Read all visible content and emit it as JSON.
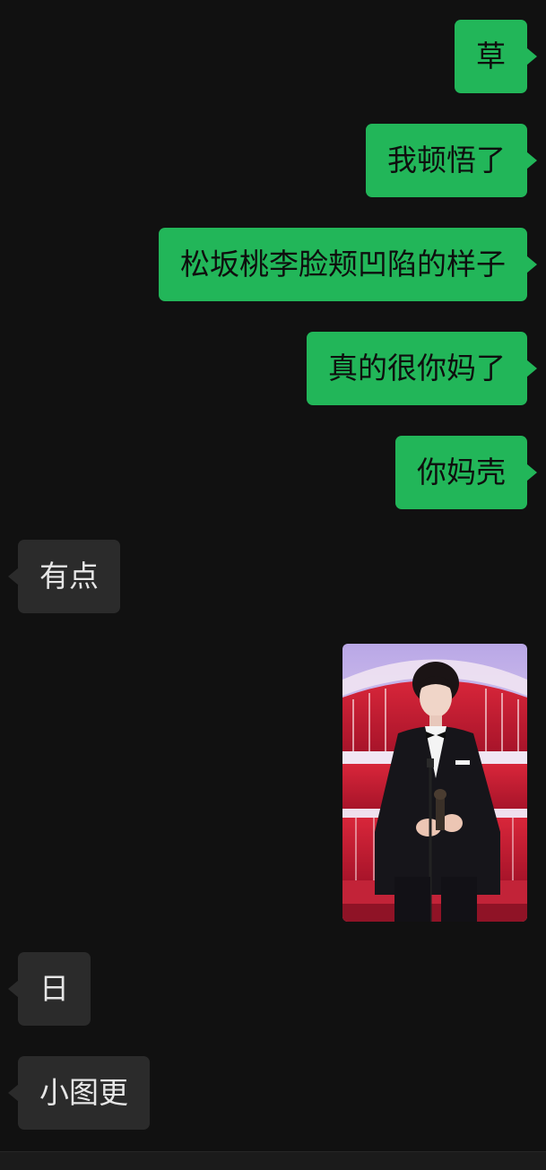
{
  "messages": [
    {
      "text": "草"
    },
    {
      "text": "我顿悟了"
    },
    {
      "text": "松坂桃李脸颊凹陷的样子"
    },
    {
      "text": "真的很你妈了"
    },
    {
      "text": "你妈壳"
    },
    {
      "text": "有点"
    },
    {
      "image": "photo-man-in-tuxedo-holding-award"
    },
    {
      "text": "日"
    },
    {
      "text": "小图更"
    }
  ],
  "colors": {
    "background": "#111111",
    "outgoing_bubble": "#22b659",
    "incoming_bubble": "#2b2b2b"
  }
}
